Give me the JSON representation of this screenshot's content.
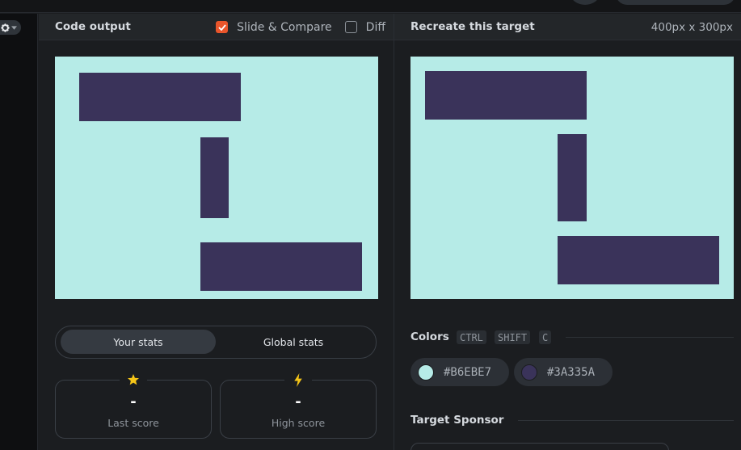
{
  "left_panel": {
    "title": "Code output",
    "slide_compare_label": "Slide & Compare",
    "slide_compare_checked": true,
    "diff_label": "Diff",
    "diff_checked": false
  },
  "right_panel": {
    "title": "Recreate this target",
    "dimensions": "400px x 300px"
  },
  "stats": {
    "tabs": [
      {
        "label": "Your stats",
        "active": true
      },
      {
        "label": "Global stats",
        "active": false
      }
    ],
    "cards": [
      {
        "icon": "star-icon",
        "value": "-",
        "label": "Last score"
      },
      {
        "icon": "lightning-icon",
        "value": "-",
        "label": "High score"
      }
    ]
  },
  "colors": {
    "title": "Colors",
    "shortcut_keys": [
      "CTRL",
      "SHIFT",
      "C"
    ],
    "swatches": [
      {
        "hex": "#B6EBE7",
        "color": "#b6ebe7"
      },
      {
        "hex": "#3A335A",
        "color": "#3a335a"
      }
    ]
  },
  "sponsor": {
    "title": "Target Sponsor"
  },
  "theme": {
    "accent": "#e9552b",
    "canvas_bg": "#b6ebe7",
    "shape_fill": "#3a335a",
    "star": "#f5c518"
  }
}
